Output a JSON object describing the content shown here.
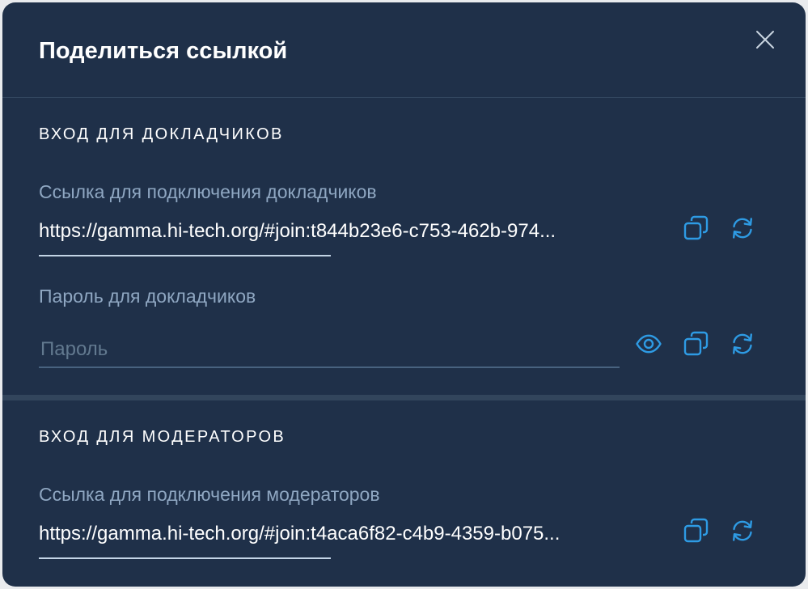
{
  "dialog": {
    "title": "Поделиться ссылкой"
  },
  "speakers": {
    "heading": "ВХОД ДЛЯ ДОКЛАДЧИКОВ",
    "link_label": "Ссылка для подключения докладчиков",
    "link_value": "https://gamma.hi-tech.org/#join:t844b23e6-c753-462b-974...",
    "password_label": "Пароль для докладчиков",
    "password_placeholder": "Пароль",
    "password_value": ""
  },
  "moderators": {
    "heading": "ВХОД ДЛЯ МОДЕРАТОРОВ",
    "link_label": "Ссылка для подключения модераторов",
    "link_value": "https://gamma.hi-tech.org/#join:t4aca6f82-c4b9-4359-b075..."
  },
  "icons": {
    "close": "close-icon",
    "copy": "copy-icon",
    "regenerate": "refresh-icon",
    "show_password": "eye-icon"
  },
  "colors": {
    "background": "#1f3049",
    "accent": "#2e9be4",
    "label": "#8fa7c2",
    "text": "#ffffff"
  }
}
